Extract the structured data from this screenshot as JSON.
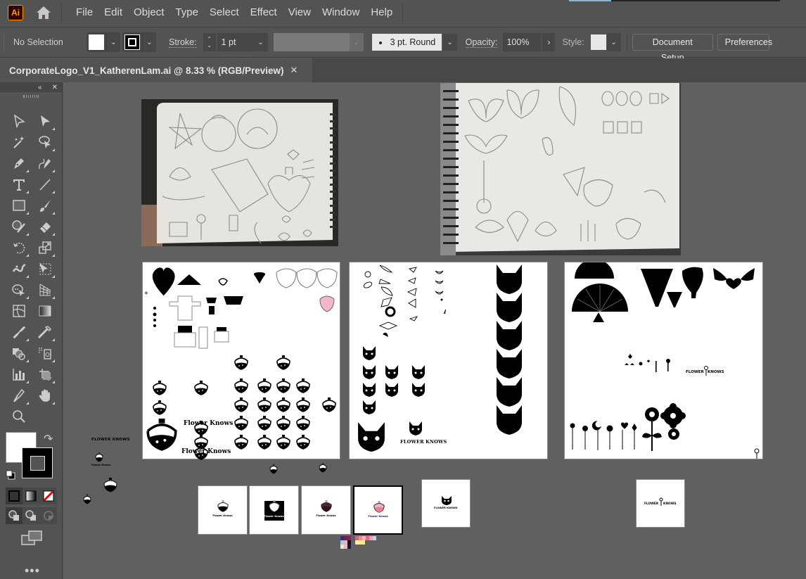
{
  "app": {
    "logo_text": "Ai",
    "menu": [
      "File",
      "Edit",
      "Object",
      "Type",
      "Select",
      "Effect",
      "View",
      "Window",
      "Help"
    ]
  },
  "control_bar": {
    "selection_status": "No Selection",
    "stroke_label": "Stroke:",
    "stroke_weight": "1 pt",
    "brush_label": "3 pt. Round",
    "opacity_label": "Opacity:",
    "opacity_value": "100%",
    "style_label": "Style:",
    "document_setup": "Document Setup",
    "preferences": "Preferences",
    "fill_color": "#ffffff",
    "stroke_color": "#000000"
  },
  "document_tab": {
    "title": "CorporateLogo_V1_KatherenLam.ai @ 8.33 % (RGB/Preview)",
    "close_icon": "close-icon"
  },
  "toolbar": {
    "collapse_icon": "«",
    "close_icon": "✕",
    "tools": [
      "selection-tool",
      "direct-selection-tool",
      "magic-wand-tool",
      "lasso-tool",
      "pen-tool",
      "curvature-tool",
      "type-tool",
      "line-segment-tool",
      "rectangle-tool",
      "paintbrush-tool",
      "shaper-tool",
      "eraser-tool",
      "rotate-tool",
      "scale-tool",
      "warp-tool",
      "free-transform-tool",
      "shape-builder-tool",
      "perspective-grid-tool",
      "mesh-tool",
      "gradient-tool",
      "blend-tool",
      "eyedropper-tool",
      "symbol-sprayer-tool",
      "live-paint-bucket-tool",
      "column-graph-tool",
      "artboard-tool",
      "slice-tool",
      "hand-tool",
      "zoom-tool"
    ],
    "fill_color": "#ffffff",
    "stroke_color": "#000000",
    "more_label": "•••"
  },
  "canvas": {
    "loose_text": {
      "flower_knows_caps": "FLOWER KNOWS",
      "flower_knows_small": "Flower Knows"
    },
    "artboard_potion": {
      "wordmark_1": "Flower Knows",
      "wordmark_2": "Flower Knows"
    },
    "artboard_cat": {
      "wordmark": "FLOWER KNOWS"
    },
    "artboard_flower": {
      "wordmark_left": "FLOWER",
      "wordmark_right": "KNOWS"
    },
    "mini_artboards": [
      {
        "caption": "Flower Knows",
        "style": "black-on-white"
      },
      {
        "caption": "Flower Knows",
        "style": "white-on-black"
      },
      {
        "caption": "Flower Knows",
        "style": "brown"
      },
      {
        "caption": "Flower Knows",
        "style": "pink"
      }
    ],
    "cat_mini_caption": "FLOWER KNOWS",
    "flower_mini_left": "FLOWER",
    "flower_mini_right": "KNOWS",
    "palette_colors": [
      [
        "#2d2f7a",
        "#9b1040",
        "#6a2a6e"
      ],
      [
        "#a9c8e6",
        "#f0b0b8",
        "#1a1010"
      ],
      [
        "#f5e2d0",
        "#f2b8b0",
        "#151838"
      ]
    ],
    "palette_colors_2": [
      "#e85a80",
      "#f08aa0",
      "#f6b6c4",
      "#e46a8c",
      "#f2a0b8",
      "#d8c8e8"
    ],
    "palette_colors_3": [
      "#f8f0a0",
      "#f4e890"
    ]
  }
}
